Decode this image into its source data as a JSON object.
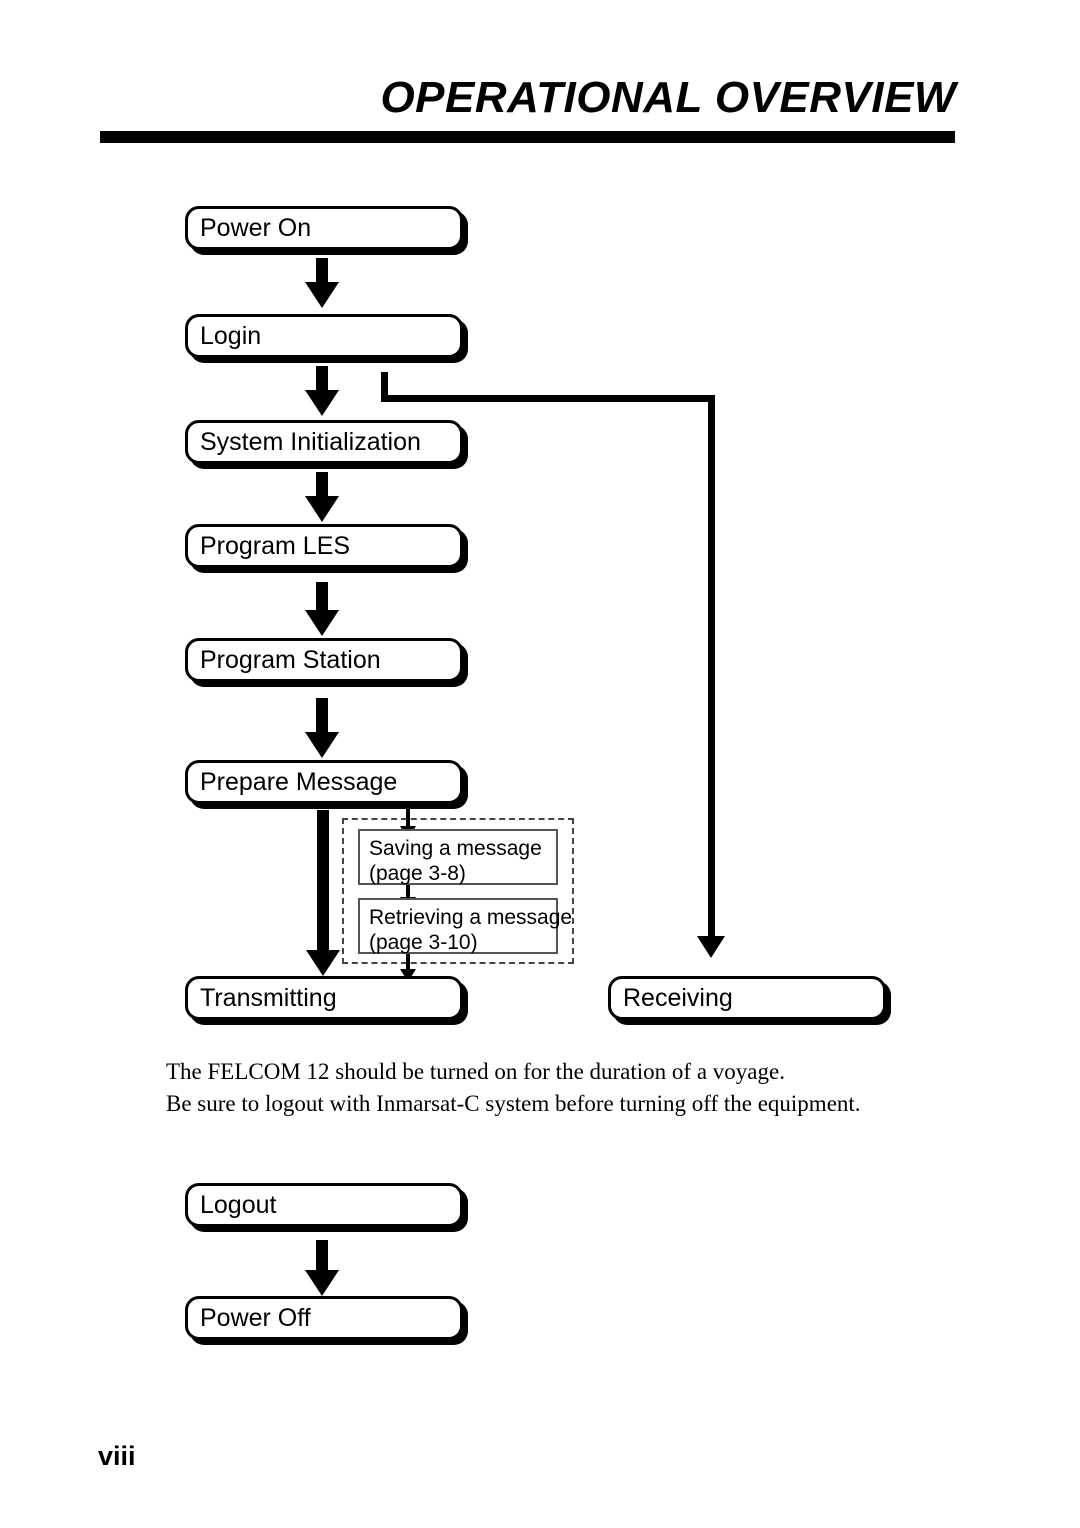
{
  "header": {
    "title": "OPERATIONAL OVERVIEW"
  },
  "flowchart": {
    "type": "flowchart",
    "main_sequence": [
      {
        "id": "power-on",
        "label": "Power On"
      },
      {
        "id": "login",
        "label": "Login"
      },
      {
        "id": "system-initialization",
        "label": "System Initialization"
      },
      {
        "id": "program-les",
        "label": "Program LES"
      },
      {
        "id": "program-station",
        "label": "Program Station"
      },
      {
        "id": "prepare-message",
        "label": "Prepare Message"
      },
      {
        "id": "transmitting",
        "label": "Transmitting"
      }
    ],
    "branch_node": {
      "id": "receiving",
      "label": "Receiving"
    },
    "optional_group": {
      "items": [
        {
          "id": "saving-a-message",
          "line1": "Saving a message",
          "line2": "(page 3-8)"
        },
        {
          "id": "retrieving-a-message",
          "line1": "Retrieving a message",
          "line2": "(page 3-10)"
        }
      ]
    },
    "shutdown_sequence": [
      {
        "id": "logout",
        "label": "Logout"
      },
      {
        "id": "power-off",
        "label": "Power Off"
      }
    ]
  },
  "note": {
    "line1": "The FELCOM 12 should be turned on for the duration of a voyage.",
    "line2": "Be sure to logout with Inmarsat-C system before turning off the equipment."
  },
  "footer": {
    "page_number": "viii"
  },
  "colors": {
    "ink": "#000000",
    "paper": "#ffffff",
    "dashed_border": "#444444"
  }
}
